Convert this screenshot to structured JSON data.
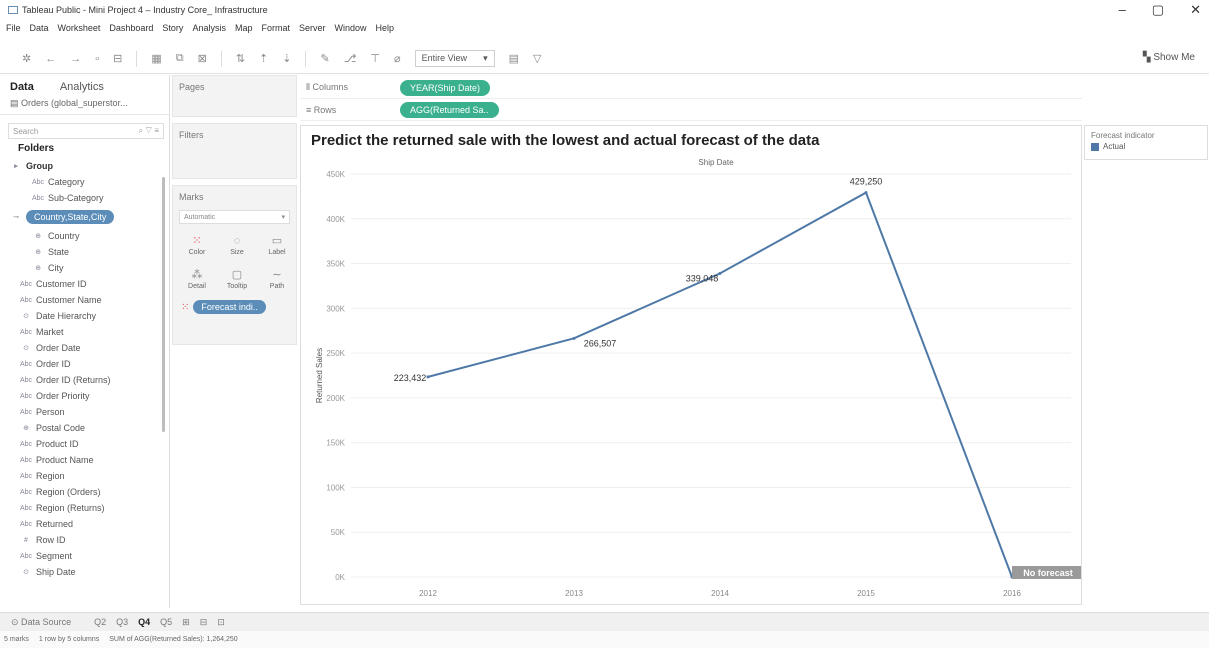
{
  "window": {
    "title": "Tableau Public - Mini Project 4 – Industry Core_ Infrastructure",
    "controls": [
      "–",
      "▢",
      "✕"
    ]
  },
  "menu": [
    "File",
    "Data",
    "Worksheet",
    "Dashboard",
    "Story",
    "Analysis",
    "Map",
    "Format",
    "Server",
    "Window",
    "Help"
  ],
  "toolbar": {
    "fit_value": "Entire View",
    "show_me": "Show Me"
  },
  "left_pane": {
    "tabs": [
      "Data",
      "Analytics"
    ],
    "data_source": "Orders (global_superstor...",
    "search_placeholder": "Search",
    "folders_label": "Folders",
    "group_label": "Group",
    "group_items": [
      "Category",
      "Sub-Category"
    ],
    "hierarchy_label": "Country,State,City",
    "hierarchy_items": [
      "Country",
      "State",
      "City"
    ],
    "fields": [
      "Customer ID",
      "Customer Name",
      "Date Hierarchy",
      "Market",
      "Order Date",
      "Order ID",
      "Order ID (Returns)",
      "Order Priority",
      "Person",
      "Postal Code",
      "Product ID",
      "Product Name",
      "Region",
      "Region (Orders)",
      "Region (Returns)",
      "Returned",
      "Row ID",
      "Segment",
      "Ship Date"
    ]
  },
  "cards": {
    "pages": "Pages",
    "filters": "Filters",
    "marks": "Marks",
    "mark_type": "Automatic",
    "mark_buttons": [
      "Color",
      "Size",
      "Label",
      "Detail",
      "Tooltip",
      "Path"
    ],
    "color_pill": "Forecast indi.."
  },
  "shelves": {
    "columns_label": "Columns",
    "columns_pill": "YEAR(Ship Date)",
    "rows_label": "Rows",
    "rows_pill": "AGG(Returned Sa.."
  },
  "chart_data": {
    "type": "line",
    "title": "Predict the returned sale with the lowest and actual forecast of the data",
    "xlabel": "Ship Date",
    "ylabel": "Returned Sales",
    "categories": [
      "2012",
      "2013",
      "2014",
      "2015",
      "2016"
    ],
    "series": [
      {
        "name": "Actual",
        "values": [
          223432,
          266507,
          339048,
          429250,
          0
        ]
      }
    ],
    "data_labels": [
      "223,432",
      "266,507",
      "339,048",
      "429,250",
      ""
    ],
    "annotation": "No forecast",
    "ylim": [
      0,
      450000
    ],
    "yticks": [
      0,
      50000,
      100000,
      150000,
      200000,
      250000,
      300000,
      350000,
      400000,
      450000
    ],
    "ytick_labels": [
      "0K",
      "50K",
      "100K",
      "150K",
      "200K",
      "250K",
      "300K",
      "350K",
      "400K",
      "450K"
    ],
    "line_color": "#4e79a7",
    "grid": true
  },
  "legend": {
    "title": "Forecast indicator",
    "items": [
      "Actual"
    ],
    "color": "#4e79a7"
  },
  "sheet_tabs": [
    "Data Source",
    "Q2",
    "Q3",
    "Q4",
    "Q5"
  ],
  "active_tab": "Q4",
  "status": {
    "marks": "5 marks",
    "dims": "1 row by 5 columns",
    "sum": "SUM of AGG(Returned Sales): 1,264,250"
  }
}
